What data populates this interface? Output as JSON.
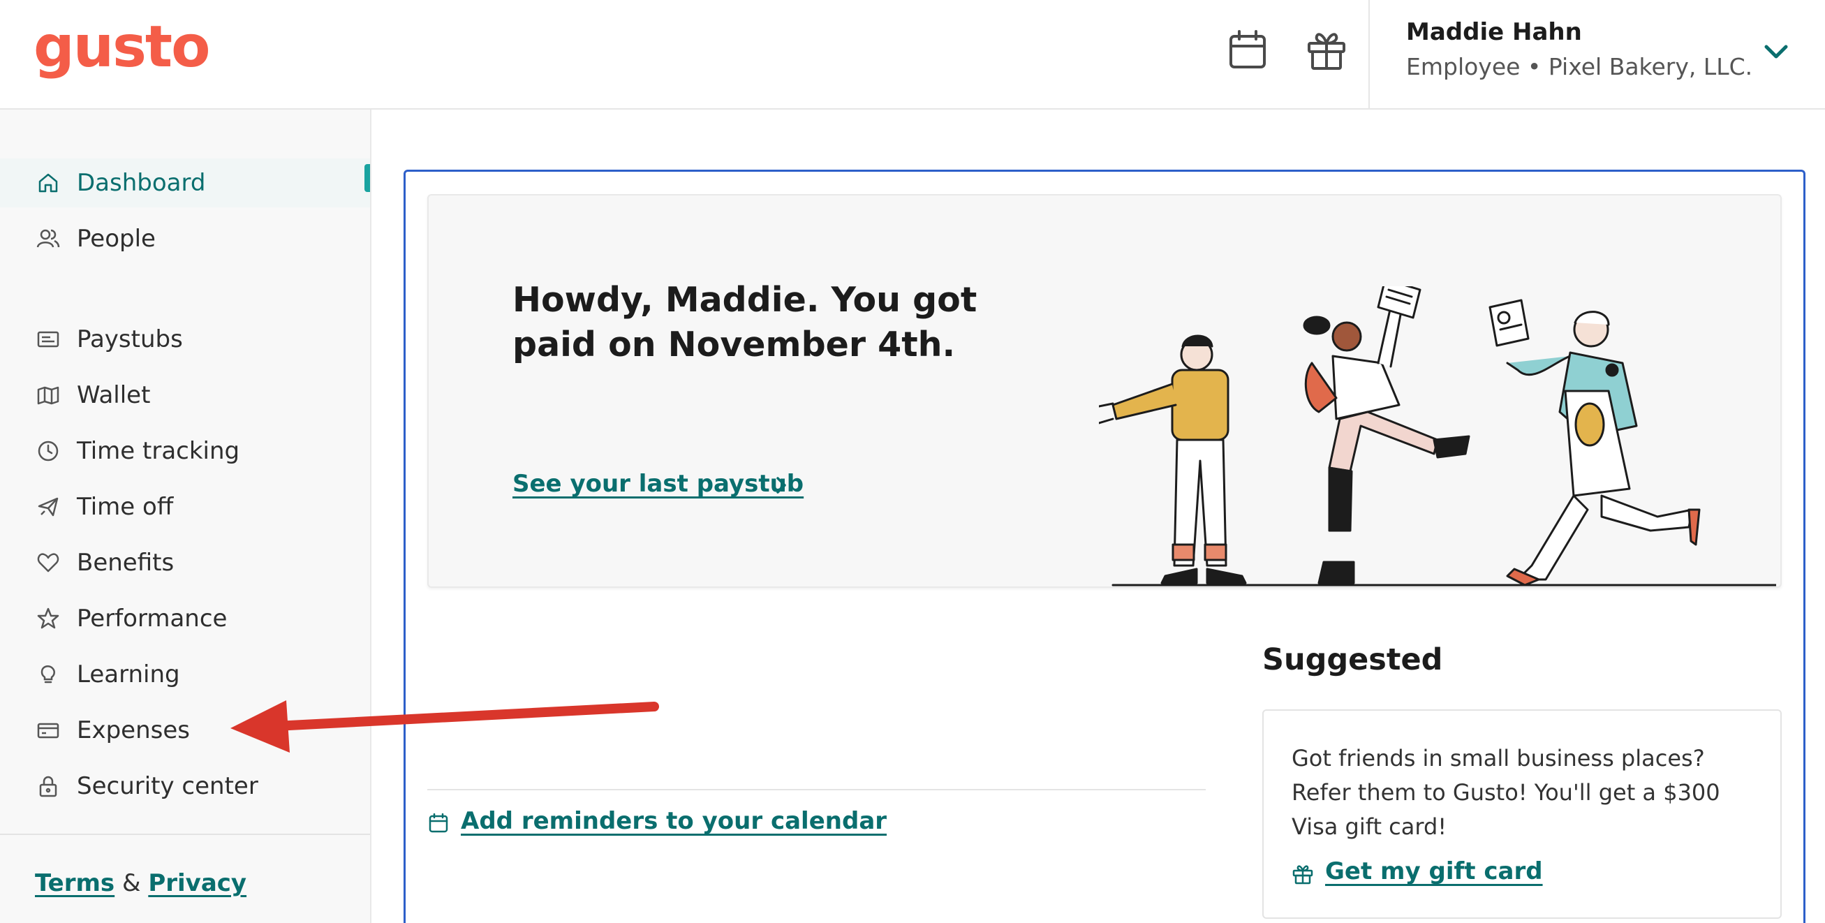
{
  "brand": {
    "logo_text": "gusto",
    "color": "#f45d48"
  },
  "header": {
    "calendar_icon": "calendar-icon",
    "gift_icon": "gift-icon",
    "user": {
      "name": "Maddie Hahn",
      "role": "Employee • Pixel Bakery, LLC."
    }
  },
  "sidebar": {
    "items": [
      {
        "label": "Dashboard",
        "icon": "home-icon",
        "active": true
      },
      {
        "label": "People",
        "icon": "people-icon"
      },
      {
        "label": "Paystubs",
        "icon": "paystub-icon"
      },
      {
        "label": "Wallet",
        "icon": "wallet-icon"
      },
      {
        "label": "Time tracking",
        "icon": "clock-icon"
      },
      {
        "label": "Time off",
        "icon": "plane-icon"
      },
      {
        "label": "Benefits",
        "icon": "heart-icon"
      },
      {
        "label": "Performance",
        "icon": "star-icon"
      },
      {
        "label": "Learning",
        "icon": "lightbulb-icon"
      },
      {
        "label": "Expenses",
        "icon": "card-icon"
      },
      {
        "label": "Security center",
        "icon": "lock-icon"
      }
    ],
    "legal": {
      "terms": "Terms",
      "and": "&",
      "privacy": "Privacy"
    }
  },
  "hero": {
    "title": "Howdy, Maddie. You got paid on November 4th.",
    "link": "See your last paystub"
  },
  "calendar_link": "Add reminders to your calendar",
  "suggested": {
    "title": "Suggested",
    "text": "Got friends in small business places? Refer them to Gusto! You'll get a $300 Visa gift card!",
    "link": "Get my gift card"
  },
  "colors": {
    "accent": "#0a6e6e",
    "active_bar": "#19a3a0",
    "focus_border": "#2d5fc9",
    "annotation_arrow": "#d9362b"
  }
}
